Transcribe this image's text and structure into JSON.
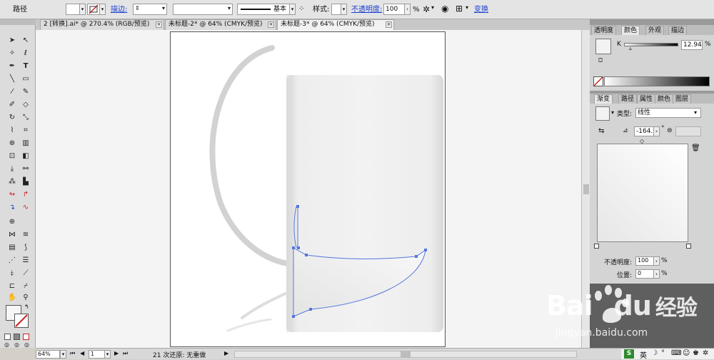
{
  "control_bar": {
    "object_label": "路径",
    "stroke_label": "描边:",
    "stroke_profile": "基本",
    "style_label": "样式:",
    "opacity_label": "不透明度:",
    "opacity_value": "100",
    "opacity_unit": "%",
    "transform_label": "变换"
  },
  "tabs": [
    {
      "label": "2 [转换].ai* @ 270.4% (RGB/预览)",
      "close": "×"
    },
    {
      "label": "未标题-2* @ 64% (CMYK/预览)",
      "close": "×"
    },
    {
      "label": "未标题-3* @ 64% (CMYK/预览)",
      "close": "×"
    }
  ],
  "color_panel": {
    "tabs": [
      "透明度",
      "颜色",
      "外观",
      "描边"
    ],
    "active_tab": "颜色",
    "channel_label": "K",
    "channel_value": "12.94",
    "channel_unit": "%",
    "slider_level": 0.1294
  },
  "gradient_panel": {
    "tabs": [
      "渐变",
      "路径",
      "属性",
      "颜色",
      "图层"
    ],
    "active_tab": "渐变",
    "type_label": "类型:",
    "type_value": "线性",
    "angle_value": "-164.",
    "angle_unit": "°",
    "opacity_label": "不透明度:",
    "opacity_value": "100",
    "opacity_unit": "%",
    "location_label": "位置:",
    "location_value": "0",
    "location_unit": "%"
  },
  "status_bar": {
    "zoom": "64%",
    "page": "1",
    "message": "21 次还原: 无重做"
  },
  "watermark": {
    "brand": "Bai",
    "brand_tail": "du",
    "brand_cn": "经验",
    "url": "jingyan.baidu.com"
  },
  "taskbar": {
    "ime_label": "英"
  },
  "colors": {
    "path_selection": "#5577dd",
    "accent_red": "#cc2222",
    "link_blue": "#1a3fd0"
  }
}
